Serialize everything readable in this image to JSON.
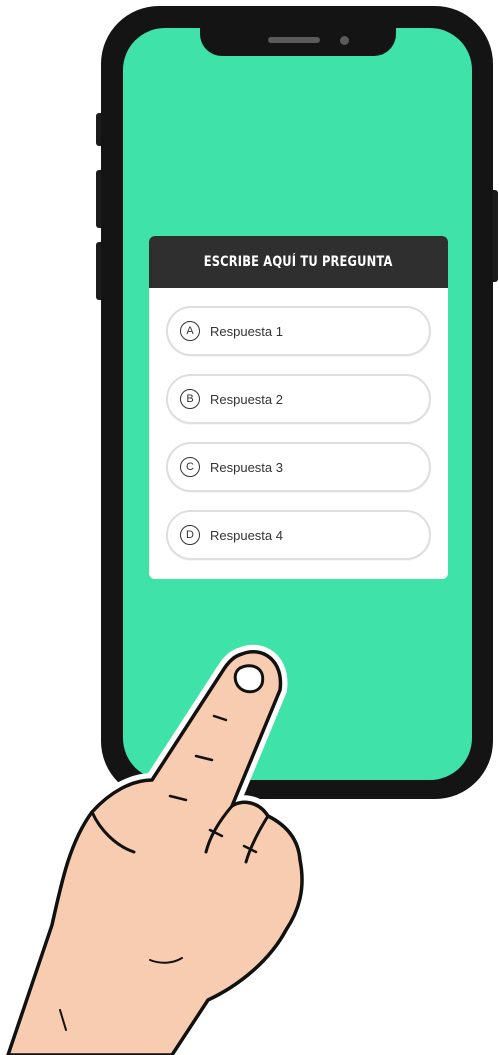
{
  "quiz": {
    "question": "ESCRIBE AQUÍ TU PREGUNTA",
    "options": [
      {
        "letter": "A",
        "label": "Respuesta 1"
      },
      {
        "letter": "B",
        "label": "Respuesta 2"
      },
      {
        "letter": "C",
        "label": "Respuesta 3"
      },
      {
        "letter": "D",
        "label": "Respuesta 4"
      }
    ]
  },
  "colors": {
    "screen_background": "#3fe3a9",
    "phone_frame": "#141414",
    "header_background": "#2f2f2f",
    "card_background": "#ffffff",
    "skin": "#f8ccb0"
  },
  "illustration": {
    "hand_icon": "pointing-hand-icon"
  }
}
